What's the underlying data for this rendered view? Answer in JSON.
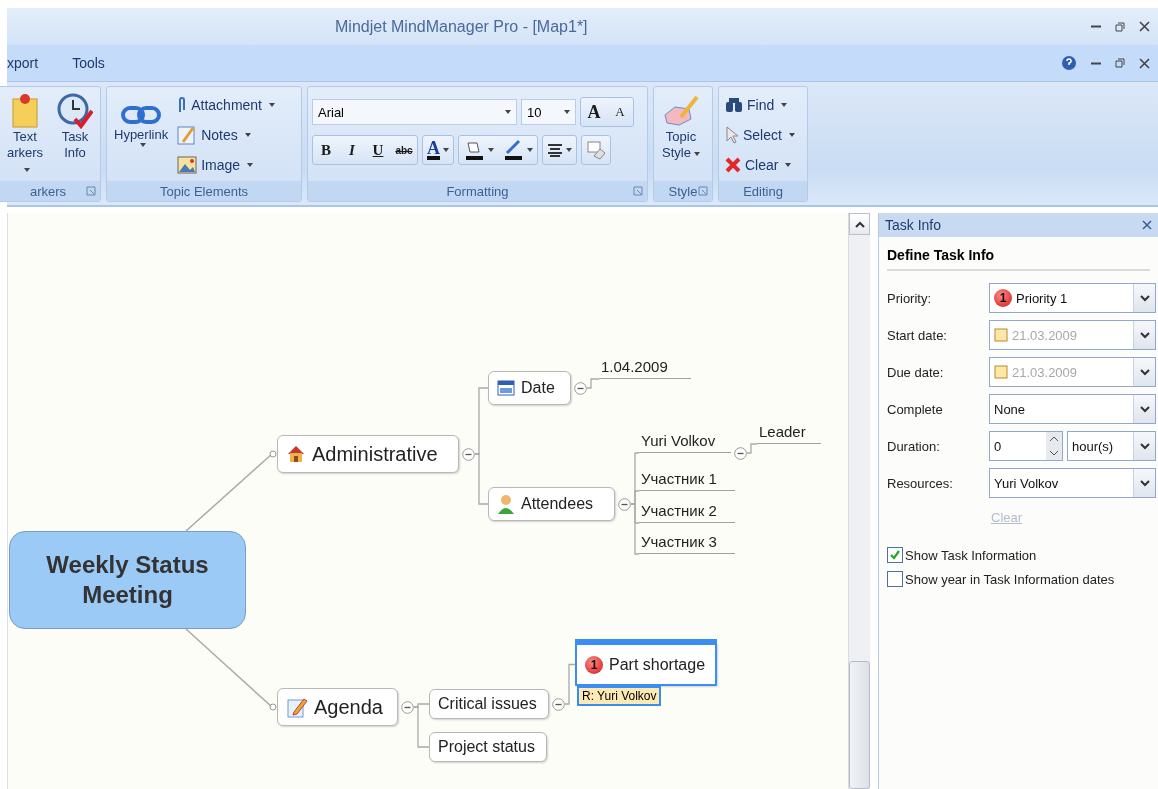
{
  "window": {
    "title": "Mindjet MindManager Pro - [Map1*]"
  },
  "menu": [
    {
      "label": "xport"
    },
    {
      "label": "Tools"
    }
  ],
  "ribbon": {
    "markers": {
      "label": "arkers",
      "launcher": true,
      "buttons": [
        {
          "lines": [
            "Text",
            "arkers"
          ],
          "dropdown": true
        },
        {
          "lines": [
            "Task",
            "Info"
          ]
        }
      ]
    },
    "topic_elements": {
      "label": "Topic Elements",
      "hyperlink": {
        "label": "Hyperlink",
        "dropdown": true
      },
      "items": [
        {
          "label": "Attachment",
          "dropdown": true
        },
        {
          "label": "Notes",
          "dropdown": true
        },
        {
          "label": "Image",
          "dropdown": true
        }
      ]
    },
    "formatting": {
      "label": "Formatting",
      "launcher": true,
      "font": "Arial",
      "size": "10",
      "grow": "A",
      "shrink": "A",
      "bold": "B",
      "italic": "I",
      "underline": "U",
      "strike": "abc",
      "font_color": "A"
    },
    "style": {
      "label": "Style",
      "launcher": true,
      "button": {
        "lines": [
          "Topic",
          "Style"
        ],
        "dropdown": true
      }
    },
    "editing": {
      "label": "Editing",
      "items": [
        {
          "label": "Find",
          "dropdown": true
        },
        {
          "label": "Select",
          "dropdown": true
        },
        {
          "label": "Clear",
          "dropdown": true
        }
      ]
    }
  },
  "map": {
    "central": {
      "text": "Weekly Status Meeting",
      "selected": false,
      "children": [
        {
          "text": "Administrative",
          "kind": "boxed",
          "selected": false,
          "expanded": true,
          "children": [
            {
              "text": "Date",
              "kind": "boxed",
              "selected": false,
              "expanded": true,
              "children": [
                {
                  "text": "1.04.2009",
                  "kind": "float",
                  "selected": false
                }
              ]
            },
            {
              "text": "Attendees",
              "kind": "boxed",
              "selected": false,
              "expanded": true,
              "children": [
                {
                  "text": "Yuri Volkov",
                  "kind": "float",
                  "selected": false,
                  "expanded": true,
                  "children": [
                    {
                      "text": "Leader",
                      "kind": "float",
                      "selected": false
                    }
                  ]
                },
                {
                  "text": "Участник 1",
                  "kind": "float",
                  "selected": false
                },
                {
                  "text": "Участник 2",
                  "kind": "float",
                  "selected": false
                },
                {
                  "text": "Участник 3",
                  "kind": "float",
                  "selected": false
                }
              ]
            }
          ]
        },
        {
          "text": "Agenda",
          "kind": "boxed",
          "selected": false,
          "expanded": true,
          "children": [
            {
              "text": "Critical issues",
              "kind": "boxed",
              "selected": false,
              "expanded": true,
              "children": [
                {
                  "text": "Part shortage",
                  "kind": "boxed",
                  "selected": true,
                  "priority": "1",
                  "resource": "R: Yuri Volkov"
                }
              ]
            },
            {
              "text": "Project status",
              "kind": "boxed",
              "selected": false
            }
          ]
        }
      ]
    }
  },
  "task_pane": {
    "title": "Task Info",
    "heading": "Define Task Info",
    "fields": [
      {
        "label": "Priority:",
        "kind": "dropdown",
        "value": "Priority 1",
        "badge": "1",
        "disabled": false
      },
      {
        "label": "Start date:",
        "kind": "date",
        "value": "21.03.2009",
        "disabled": true
      },
      {
        "label": "Due date:",
        "kind": "date",
        "value": "21.03.2009",
        "disabled": true
      },
      {
        "label": "Complete",
        "kind": "dropdown",
        "value": "None",
        "disabled": false
      },
      {
        "label": "Duration:",
        "kind": "spinner",
        "value": "0",
        "unit": "hour(s)",
        "disabled": false
      },
      {
        "label": "Resources:",
        "kind": "dropdown",
        "value": "Yuri Volkov",
        "disabled": false
      }
    ],
    "clear": {
      "label": "Clear",
      "disabled": true
    },
    "options": [
      {
        "label": "Show Task Information",
        "checked": true
      },
      {
        "label": "Show year in Task Information dates",
        "checked": false
      }
    ]
  }
}
